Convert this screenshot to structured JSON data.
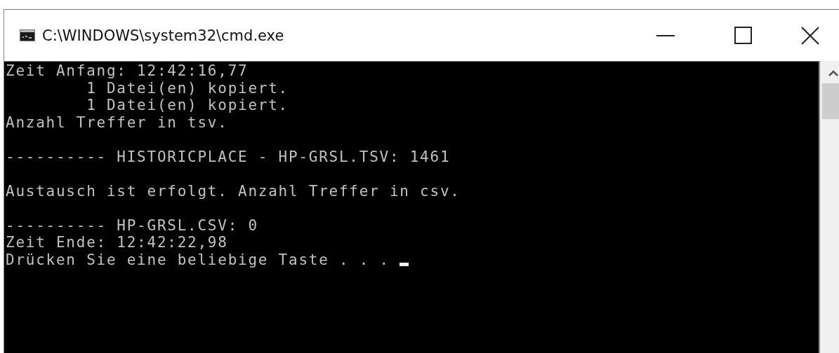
{
  "window": {
    "title": "C:\\WINDOWS\\system32\\cmd.exe"
  },
  "console": {
    "lines": [
      {
        "kind": "text",
        "text": "Zeit Anfang: 12:42:16,77",
        "cursor": false
      },
      {
        "kind": "text",
        "text": "        1 Datei(en) kopiert.",
        "cursor": false
      },
      {
        "kind": "text",
        "text": "        1 Datei(en) kopiert.",
        "cursor": false
      },
      {
        "kind": "text",
        "text": "Anzahl Treffer in tsv.",
        "cursor": false
      },
      {
        "kind": "blank"
      },
      {
        "kind": "text",
        "text": "---------- HISTORICPLACE - HP-GRSL.TSV: 1461",
        "cursor": false
      },
      {
        "kind": "blank"
      },
      {
        "kind": "text",
        "text": "Austausch ist erfolgt. Anzahl Treffer in csv.",
        "cursor": false
      },
      {
        "kind": "blank"
      },
      {
        "kind": "text",
        "text": "---------- HP-GRSL.CSV: 0",
        "cursor": false
      },
      {
        "kind": "text",
        "text": "Zeit Ende: 12:42:22,98",
        "cursor": false
      },
      {
        "kind": "text",
        "text": "Drücken Sie eine beliebige Taste . . . ",
        "cursor": true
      }
    ]
  }
}
